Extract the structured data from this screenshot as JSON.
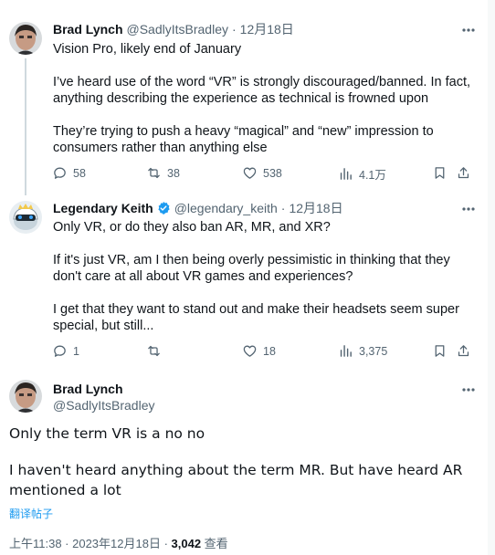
{
  "tweet1": {
    "name": "Brad Lynch",
    "handle": "@SadlyItsBradley",
    "date": "12月18日",
    "paragraphs": [
      "Vision Pro, likely end of January",
      "I’ve heard use of the word “VR” is strongly discouraged/banned. In fact, anything describing the experience as technical is frowned upon",
      "They’re trying to push a heavy “magical” and “new” impression to consumers rather than anything else"
    ],
    "stats": {
      "replies": "58",
      "reposts": "38",
      "likes": "538",
      "views": "4.1万"
    }
  },
  "tweet2": {
    "name": "Legendary Keith",
    "handle": "@legendary_keith",
    "date": "12月18日",
    "paragraphs": [
      "Only VR, or do they also ban AR, MR, and XR?",
      "If it's just VR, am I then being overly pessimistic in thinking that they don't care at all about VR games and experiences?",
      "I get that they want to stand out and make their headsets seem super special, but still..."
    ],
    "stats": {
      "replies": "1",
      "reposts": "",
      "likes": "18",
      "views": "3,375"
    }
  },
  "main_tweet": {
    "name": "Brad Lynch",
    "handle": "@SadlyItsBradley",
    "paragraphs": [
      "Only the term VR is a no no",
      "I haven't heard anything about the term MR. But have heard AR mentioned a lot"
    ],
    "translate_label": "翻译帖子",
    "timestamp": "上午11:38 · 2023年12月18日 · ",
    "views_count": "3,042",
    "views_label": " 查看"
  },
  "colors": {
    "accent": "#1d9bf0",
    "secondary_text": "#536471",
    "divider": "#eff3f4"
  }
}
